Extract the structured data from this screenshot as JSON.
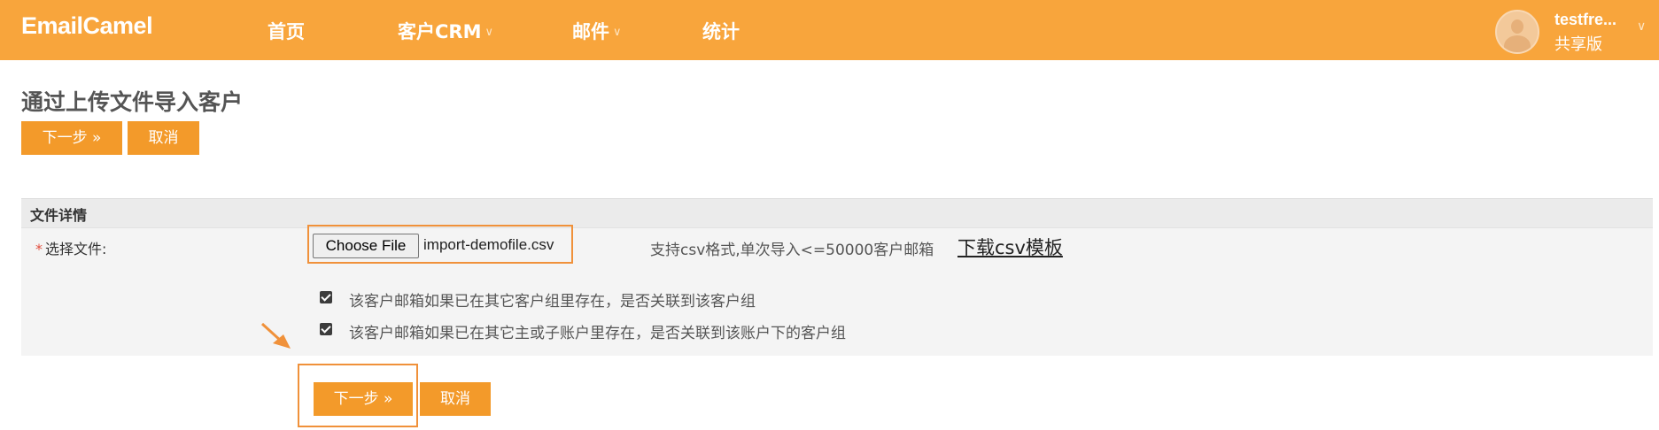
{
  "header": {
    "logo": "EmailCamel",
    "nav": [
      {
        "label": "首页",
        "has_dropdown": false
      },
      {
        "label": "客户CRM",
        "has_dropdown": true
      },
      {
        "label": "邮件",
        "has_dropdown": true
      },
      {
        "label": "统计",
        "has_dropdown": false
      }
    ],
    "user": {
      "name": "testfre...",
      "plan": "共享版"
    },
    "bar_color": "#f8a53c"
  },
  "page": {
    "title": "通过上传文件导入客户",
    "next_label": "下一步 »",
    "cancel_label": "取消"
  },
  "form": {
    "section_title": "文件详情",
    "file_label": "选择文件:",
    "required_mark": "*",
    "choose_file_label": "Choose File",
    "file_name": "import-demofile.csv",
    "hint": "支持csv格式,单次导入<=50000客户邮箱",
    "template_link": "下载csv模板",
    "options": [
      {
        "label": "该客户邮箱如果已在其它客户组里存在，是否关联到该客户组",
        "checked": true
      },
      {
        "label": "该客户邮箱如果已在其它主或子账户里存在，是否关联到该账户下的客户组",
        "checked": true
      }
    ],
    "next_label": "下一步 »",
    "cancel_label": "取消"
  },
  "icons": [
    "chevron-down-icon",
    "avatar-icon",
    "checkbox-checked-icon",
    "annotation-arrow-icon"
  ],
  "colors": {
    "accent": "#f39a2a",
    "highlight": "#f0913a",
    "required": "#e24d3d"
  }
}
